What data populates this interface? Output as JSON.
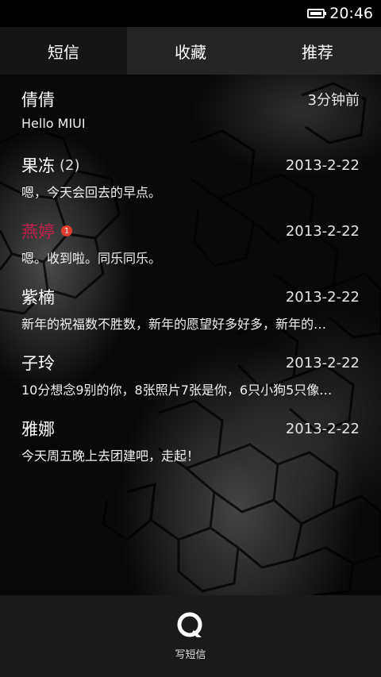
{
  "status_bar": {
    "time": "20:46"
  },
  "tabs": [
    {
      "label": "短信",
      "active": true
    },
    {
      "label": "收藏",
      "active": false
    },
    {
      "label": "推荐",
      "active": false
    }
  ],
  "conversations": [
    {
      "name": "倩倩",
      "count": "",
      "unread_badge": "",
      "time": "3分钟前",
      "preview": "Hello MIUI"
    },
    {
      "name": "果冻",
      "count": "(2)",
      "unread_badge": "",
      "time": "2013-2-22",
      "preview": "嗯，今天会回去的早点。"
    },
    {
      "name": "燕婷",
      "count": "",
      "unread_badge": "1",
      "time": "2013-2-22",
      "preview": "嗯。收到啦。同乐同乐。"
    },
    {
      "name": "紫楠",
      "count": "",
      "unread_badge": "",
      "time": "2013-2-22",
      "preview": "新年的祝福数不胜数，新年的愿望好多好多，新年的…"
    },
    {
      "name": "子玲",
      "count": "",
      "unread_badge": "",
      "time": "2013-2-22",
      "preview": "10分想念9别的你，8张照片7张是你，6只小狗5只像…"
    },
    {
      "name": "雅娜",
      "count": "",
      "unread_badge": "",
      "time": "2013-2-22",
      "preview": "今天周五晚上去团建吧，走起！"
    }
  ],
  "bottom_bar": {
    "compose_label": "写短信",
    "compose_icon": "compose-message-icon"
  },
  "colors": {
    "unread_name": "#c2204a",
    "badge": "#e23b2e",
    "tab_active": "#161616",
    "tab_inactive": "#282628"
  }
}
